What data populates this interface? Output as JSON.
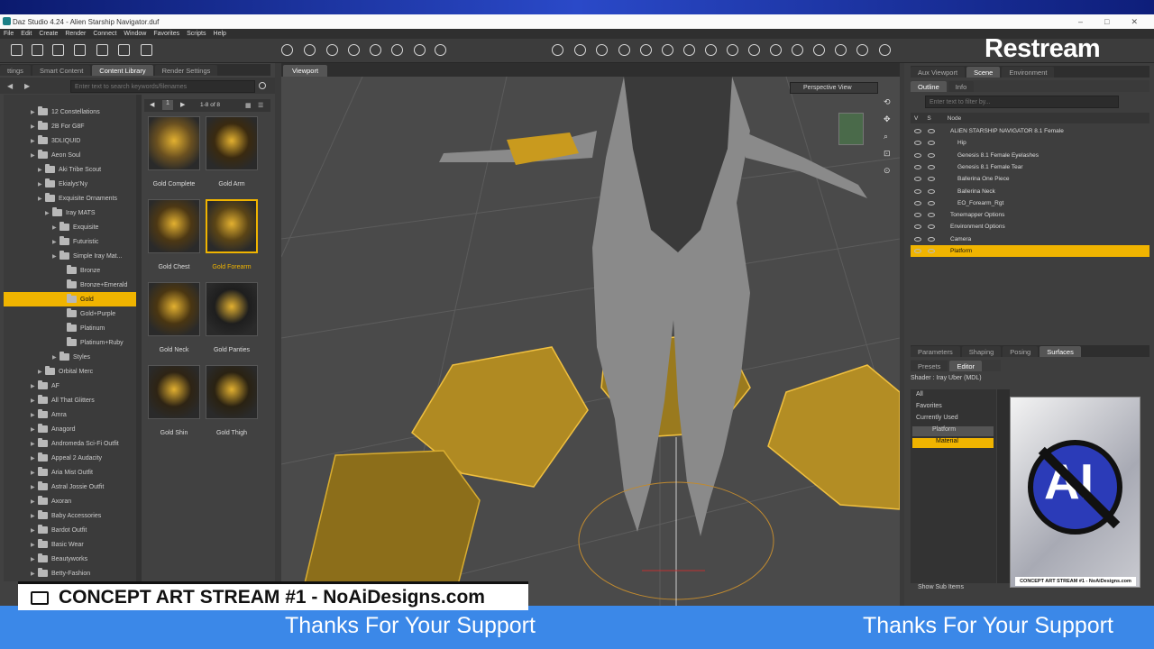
{
  "window": {
    "title": "Daz Studio 4.24 - Alien Starship Navigator.duf",
    "menus": [
      "File",
      "Edit",
      "Create",
      "Render",
      "Connect",
      "Window",
      "Favorites",
      "Scripts",
      "Help"
    ]
  },
  "overlay": {
    "restream": "Restream",
    "concept_title": "CONCEPT ART STREAM #1 - NoAiDesigns.com",
    "banner_left": "Thanks For Your Support",
    "banner_right": "Thanks For Your Support",
    "ai_caption": "CONCEPT ART STREAM #1 - NoAiDesigns.com",
    "ai_logo_text": "AI"
  },
  "left_panel": {
    "tabs": [
      "ttings",
      "Smart Content",
      "Content Library",
      "Render Settings"
    ],
    "search_placeholder": "Enter text to search keywords/filenames",
    "page_info": "1-8 of 8",
    "page_num": "1",
    "tree": [
      {
        "label": "12 Constellations",
        "indent": 1
      },
      {
        "label": "2B For G8F",
        "indent": 1
      },
      {
        "label": "3DLIQUID",
        "indent": 1
      },
      {
        "label": "Aeon Soul",
        "indent": 1
      },
      {
        "label": "Aki Tribe Scout",
        "indent": 2
      },
      {
        "label": "Ekialys'Ny",
        "indent": 2
      },
      {
        "label": "Exquisite Ornaments",
        "indent": 2
      },
      {
        "label": "Iray MATS",
        "indent": 3
      },
      {
        "label": "Exquisite",
        "indent": 4
      },
      {
        "label": "Futuristic",
        "indent": 4
      },
      {
        "label": "Simple Iray Mat...",
        "indent": 4
      },
      {
        "label": "Bronze",
        "indent": 5
      },
      {
        "label": "Bronze+Emerald",
        "indent": 5
      },
      {
        "label": "Gold",
        "indent": 5,
        "selected": true
      },
      {
        "label": "Gold+Purple",
        "indent": 5
      },
      {
        "label": "Platinum",
        "indent": 5
      },
      {
        "label": "Platinum+Ruby",
        "indent": 5
      },
      {
        "label": "Styles",
        "indent": 4
      },
      {
        "label": "Orbital Merc",
        "indent": 2
      },
      {
        "label": "AF",
        "indent": 1
      },
      {
        "label": "All That Glitters",
        "indent": 1
      },
      {
        "label": "Amra",
        "indent": 1
      },
      {
        "label": "Anagord",
        "indent": 1
      },
      {
        "label": "Andromeda Sci-Fi Outfit",
        "indent": 1
      },
      {
        "label": "Appeal 2 Audacity",
        "indent": 1
      },
      {
        "label": "Aria Mist Outfit",
        "indent": 1
      },
      {
        "label": "Astral Jossie Outfit",
        "indent": 1
      },
      {
        "label": "Axoran",
        "indent": 1
      },
      {
        "label": "Baby Accessories",
        "indent": 1
      },
      {
        "label": "Bardot Outfit",
        "indent": 1
      },
      {
        "label": "Basic Wear",
        "indent": 1
      },
      {
        "label": "Beautyworks",
        "indent": 1
      },
      {
        "label": "Betty-Fashion",
        "indent": 1
      }
    ],
    "thumbs": [
      {
        "label": "Gold Complete"
      },
      {
        "label": "Gold Arm"
      },
      {
        "label": "Gold Chest"
      },
      {
        "label": "Gold Forearm",
        "selected": true
      },
      {
        "label": "Gold Neck"
      },
      {
        "label": "Gold Panties"
      },
      {
        "label": "Gold Shin"
      },
      {
        "label": "Gold Thigh"
      }
    ]
  },
  "viewport": {
    "tab": "Viewport",
    "camera": "Perspective View"
  },
  "scene_panel": {
    "tabs": [
      "Aux Viewport",
      "Scene",
      "Environment"
    ],
    "subtabs": [
      "Outline",
      "Info"
    ],
    "filter_placeholder": "Enter text to filter by...",
    "columns": [
      "V",
      "S",
      "Node"
    ],
    "nodes": [
      {
        "label": "ALIEN STARSHIP NAVIGATOR 8.1 Female",
        "indent": 0
      },
      {
        "label": "Hip",
        "indent": 1
      },
      {
        "label": "Genesis 8.1 Female Eyelashes",
        "indent": 1
      },
      {
        "label": "Genesis 8.1 Female Tear",
        "indent": 1
      },
      {
        "label": "Ballerina One Piece",
        "indent": 1
      },
      {
        "label": "Ballerina Neck",
        "indent": 1
      },
      {
        "label": "EO_Forearm_Rgt",
        "indent": 1
      },
      {
        "label": "Tonemapper Options",
        "indent": 0
      },
      {
        "label": "Environment Options",
        "indent": 0
      },
      {
        "label": "Camera",
        "indent": 0
      },
      {
        "label": "Platform",
        "indent": 0,
        "selected": true
      }
    ]
  },
  "surfaces_panel": {
    "tabs": [
      "Parameters",
      "Shaping",
      "Posing",
      "Surfaces"
    ],
    "subtabs": [
      "Presets",
      "Editor"
    ],
    "shader": "Shader : Iray Uber (MDL)",
    "list": [
      "All",
      "Favorites",
      "Currently Used"
    ],
    "platform": "Platform",
    "material": "Material",
    "show_sub": "Show Sub Items"
  },
  "colors": {
    "accent": "#f0b400",
    "banner": "#3b88e8"
  }
}
